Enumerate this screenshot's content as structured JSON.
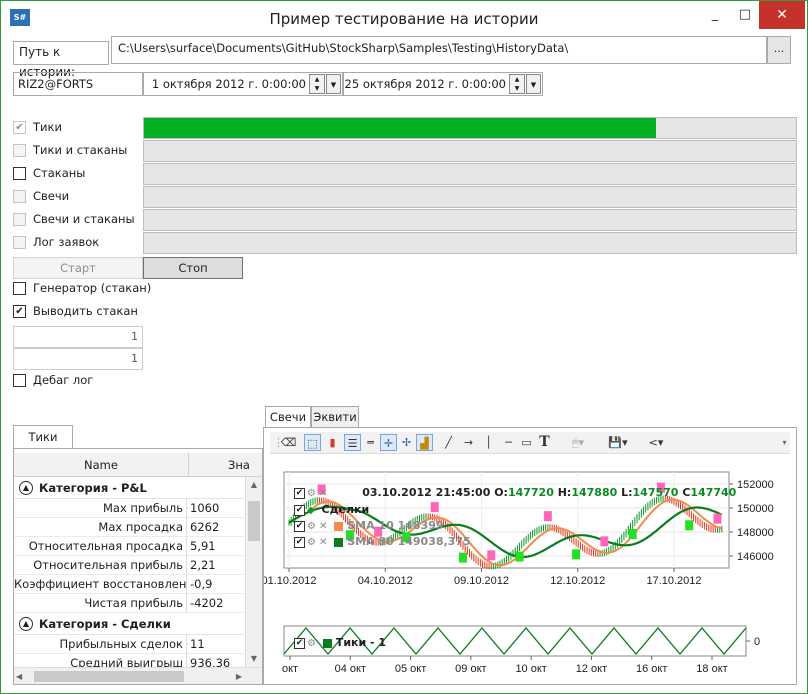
{
  "window": {
    "icon_text": "S#",
    "title": "Пример тестирование на истории",
    "minimize": "_",
    "maximize": "□",
    "close": "✕"
  },
  "path": {
    "label": "Путь к истории:",
    "value": "C:\\Users\\surface\\Documents\\GitHub\\StockSharp\\Samples\\Testing\\HistoryData\\",
    "browse": "..."
  },
  "security": "RIZ2@FORTS",
  "date_from": "1 октября 2012 г. 0:00:00",
  "date_to": "25 октября 2012 г. 0:00:00",
  "modes": [
    {
      "label": "Тики",
      "checked": true,
      "enabled": false,
      "progress": 0.785
    },
    {
      "label": "Тики и стаканы",
      "checked": false,
      "enabled": false,
      "progress": 0
    },
    {
      "label": "Стаканы",
      "checked": false,
      "enabled": true,
      "progress": 0
    },
    {
      "label": "Свечи",
      "checked": false,
      "enabled": false,
      "progress": 0
    },
    {
      "label": "Свечи и стаканы",
      "checked": false,
      "enabled": false,
      "progress": 0
    },
    {
      "label": "Лог заявок",
      "checked": false,
      "enabled": false,
      "progress": 0
    }
  ],
  "buttons": {
    "start": "Старт",
    "stop": "Стоп"
  },
  "options": {
    "generator": "Генератор (стакан)",
    "show_depth": "Выводить стакан",
    "value1": "1",
    "value2": "1",
    "debug_log": "Дебаг лог"
  },
  "stats": {
    "tab": "Тики",
    "col_name": "Name",
    "col_value": "Зна",
    "categories": [
      {
        "label": "Категория - P&L",
        "rows": [
          {
            "name": "Max прибыль",
            "value": "1060"
          },
          {
            "name": "Max просадка",
            "value": "6262"
          },
          {
            "name": "Относительная просадка",
            "value": "5,91"
          },
          {
            "name": "Относительная прибыль",
            "value": "2,21"
          },
          {
            "name": "Коэффициент восстановления",
            "value": "-0,9"
          },
          {
            "name": "Чистая прибыль",
            "value": "-4202"
          }
        ]
      },
      {
        "label": "Категория - Сделки",
        "rows": [
          {
            "name": "Прибыльных сделок",
            "value": "11"
          },
          {
            "name": "Средний выигрыш",
            "value": "936,36"
          }
        ]
      }
    ]
  },
  "chart_tabs": [
    "Свечи",
    "Эквити"
  ],
  "toolbar_icons": [
    "eraser-icon",
    "cursor-icon",
    "candle-icon",
    "list-icon",
    "hlines-icon",
    "crosshair-icon",
    "crosshair-add-icon",
    "bars-icon",
    "line-icon",
    "arrow-icon",
    "vline-icon",
    "hline-icon",
    "rect-icon",
    "text-icon",
    "mouse-icon",
    "save-icon",
    "share-icon"
  ],
  "chart_data": [
    {
      "type": "candlestick",
      "x_tick_labels": [
        "01.10.2012",
        "04.10.2012",
        "09.10.2012",
        "12.10.2012",
        "17.10.2012"
      ],
      "y_tick_labels": [
        "146000",
        "148000",
        "150000",
        "152000"
      ],
      "ylim": [
        145000,
        153000
      ],
      "ohlc_label": "03.10.2012 21:45:00",
      "open": 147720,
      "high": 147880,
      "low": 147570,
      "close_prefix": "C",
      "close_label": "147740",
      "trades_label": "Сделки",
      "series": [
        {
          "name": "SMA 10",
          "value_label": "148399",
          "color": "#f28c4a"
        },
        {
          "name": "SMA 80",
          "value_label": "149038,375",
          "color": "#0a7d1e"
        }
      ],
      "colors": {
        "up": "#0a9a25",
        "down": "#e8321c",
        "buy": "#22e022",
        "sell": "#ff66bb"
      }
    },
    {
      "type": "line",
      "series_name": "Тики",
      "series_label": "Тики - 1",
      "series_color": "#0a7d1e",
      "y_tick_labels": [
        "0"
      ],
      "x_tick_labels": [
        "окт",
        "04 окт",
        "05 окт",
        "09 окт",
        "10 окт",
        "12 окт",
        "16 окт",
        "18 окт"
      ]
    }
  ]
}
